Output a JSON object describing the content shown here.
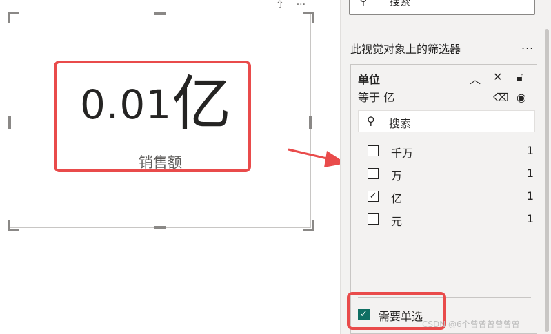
{
  "visual": {
    "kpi_number": "0.01",
    "kpi_unit": "亿",
    "kpi_label": "销售额"
  },
  "pane": {
    "search_placeholder": "搜索",
    "title": "此视觉对象上的筛选器",
    "more_label": "...",
    "filter": {
      "field": "单位",
      "condition": "等于 亿",
      "search_placeholder": "搜索",
      "options": [
        {
          "label": "千万",
          "count": "1",
          "checked": false
        },
        {
          "label": "万",
          "count": "1",
          "checked": false
        },
        {
          "label": "亿",
          "count": "1",
          "checked": true
        },
        {
          "label": "元",
          "count": "1",
          "checked": false
        }
      ],
      "require_single_label": "需要单选",
      "require_single_checked": true
    }
  },
  "colors": {
    "highlight_red": "#e94b4b",
    "checkbox_teal": "#0f6f63"
  },
  "watermark": "CSDN @6个曾曾曾曾曾曾"
}
